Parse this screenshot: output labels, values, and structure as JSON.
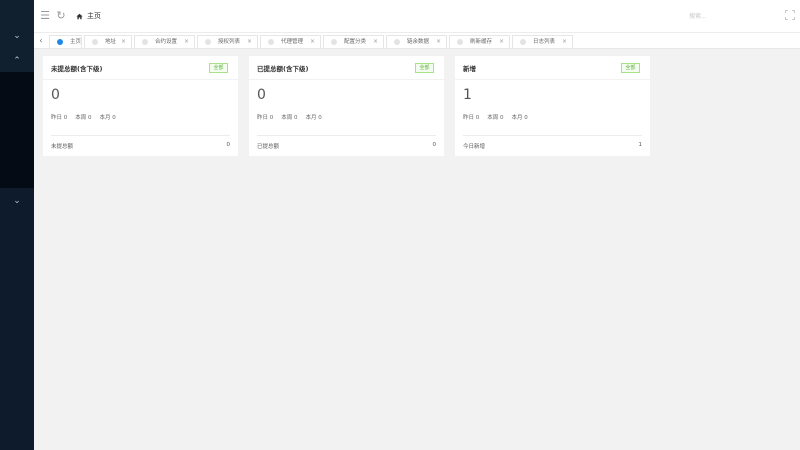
{
  "sidebar": {
    "toggles": [
      {
        "icon": "chevron-down-icon",
        "glyph": "⌄"
      },
      {
        "icon": "chevron-up-icon",
        "glyph": "⌃"
      },
      {
        "icon": "chevron-down-icon",
        "glyph": "⌄"
      }
    ]
  },
  "header": {
    "menu_icon": "☰",
    "refresh_icon": "↻",
    "home_label": "主页",
    "search_placeholder": "搜索..."
  },
  "tabs": [
    {
      "label": "主页",
      "active": true,
      "closable": false
    },
    {
      "label": "地址",
      "active": false,
      "closable": true
    },
    {
      "label": "合约设置",
      "active": false,
      "closable": true
    },
    {
      "label": "授权列表",
      "active": false,
      "closable": true
    },
    {
      "label": "代理管理",
      "active": false,
      "closable": true
    },
    {
      "label": "配置分类",
      "active": false,
      "closable": true
    },
    {
      "label": "链余数据",
      "active": false,
      "closable": true
    },
    {
      "label": "刷新缓存",
      "active": false,
      "closable": true
    },
    {
      "label": "日志列表",
      "active": false,
      "closable": true
    }
  ],
  "tab_close_glyph": "×",
  "tab_prev_glyph": "‹",
  "cards": [
    {
      "title": "未提总额(含下级)",
      "badge": "全部",
      "value": "0",
      "stats": [
        "昨日 0",
        "本周 0",
        "本月 0"
      ],
      "footer_label": "未提总额",
      "footer_value": "0"
    },
    {
      "title": "已提总额(含下级)",
      "badge": "全部",
      "value": "0",
      "stats": [
        "昨日 0",
        "本周 0",
        "本月 0"
      ],
      "footer_label": "已提总额",
      "footer_value": "0"
    },
    {
      "title": "新增",
      "badge": "全部",
      "value": "1",
      "stats": [
        "昨日 0",
        "本周 0",
        "本月 0"
      ],
      "footer_label": "今日新增",
      "footer_value": "1"
    }
  ],
  "colors": {
    "sidebar": "#0e1b2c",
    "accent": "#1e88e5",
    "badge_green": "#5bb53a"
  }
}
